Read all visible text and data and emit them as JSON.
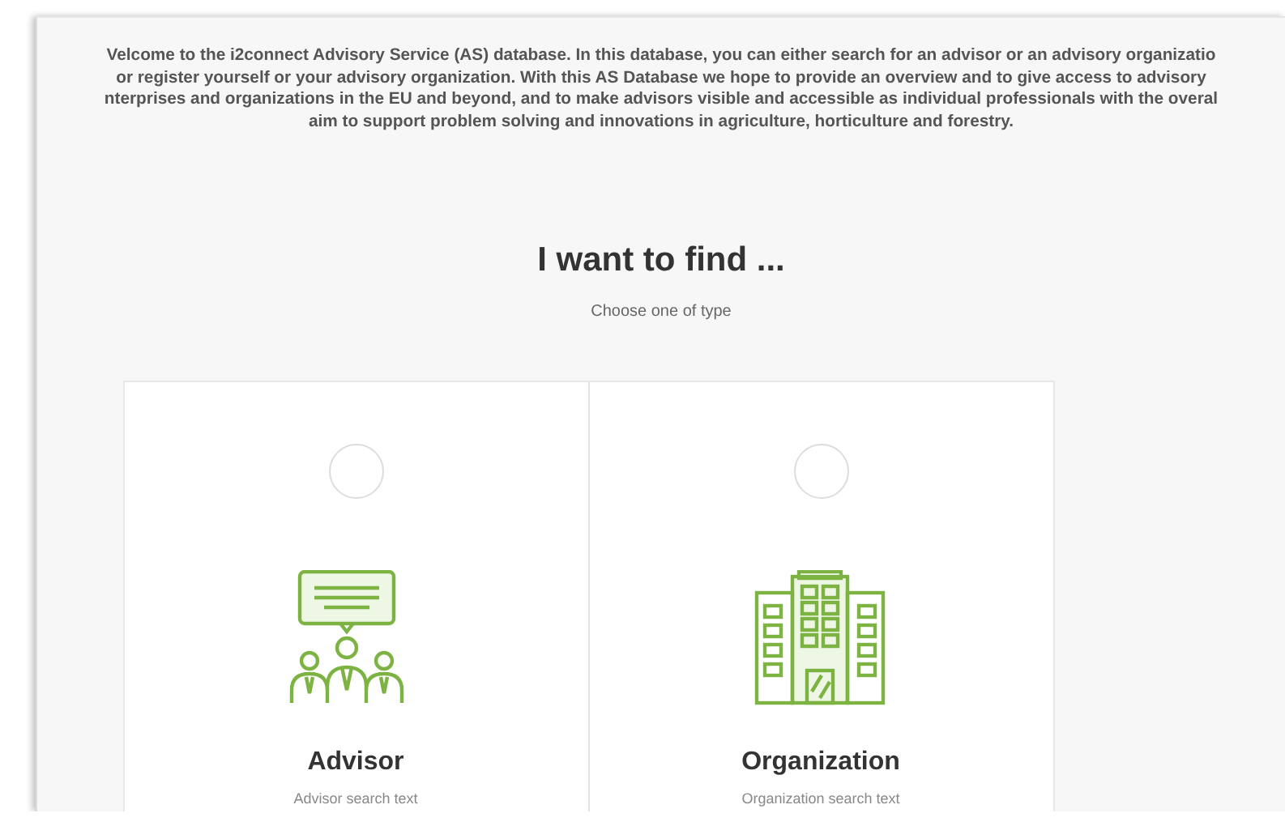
{
  "intro_lines": [
    "Velcome to the i2connect Advisory Service (AS) database. In this database, you can either search for an advisor or an advisory organizatio",
    "or register yourself or your advisory organization. With this AS Database we hope to provide an overview and to give access to advisory",
    "nterprises and organizations in the EU and beyond, and to make advisors visible and accessible as individual professionals with the overal",
    "aim to support problem solving and innovations in agriculture, horticulture and forestry."
  ],
  "heading": "I want to find ...",
  "subheading": "Choose one of type",
  "options": [
    {
      "kind": "advisor",
      "title": "Advisor",
      "description": "Advisor search text",
      "selected": false
    },
    {
      "kind": "organization",
      "title": "Organization",
      "description": "Organization search text",
      "selected": false
    }
  ]
}
